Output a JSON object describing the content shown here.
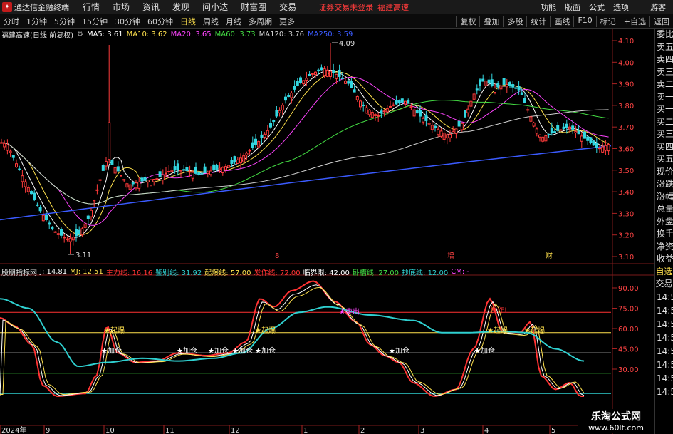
{
  "app": {
    "title": "通达信金融终端",
    "menus": [
      "行情",
      "市场",
      "资讯",
      "发现",
      "问小达",
      "财富圈",
      "交易"
    ],
    "notice_text": "证券交易未登录",
    "notice_stock": "福建高速",
    "right_menus": [
      "功能",
      "版面",
      "公式",
      "选项"
    ],
    "guest_label": "游客"
  },
  "toolbar": {
    "periods": [
      "分时",
      "1分钟",
      "5分钟",
      "15分钟",
      "30分钟",
      "60分钟",
      "日线",
      "周线",
      "月线",
      "多周期",
      "更多"
    ],
    "active_period": "日线",
    "tools": [
      "复权",
      "叠加",
      "多股",
      "统计",
      "画线",
      "F10",
      "标记",
      "+自选",
      "返回"
    ]
  },
  "price_chart": {
    "stock_title": "福建高速(日线 前复权)",
    "ma": [
      {
        "label": "MA5: 3.61",
        "color": "#ffffff"
      },
      {
        "label": "MA10: 3.62",
        "color": "#ffe14d"
      },
      {
        "label": "MA20: 3.65",
        "color": "#ff44ff"
      },
      {
        "label": "MA60: 3.73",
        "color": "#44dd44"
      },
      {
        "label": "MA120: 3.76",
        "color": "#d0d0d0"
      },
      {
        "label": "MA250: 3.59",
        "color": "#3b5bff"
      }
    ],
    "y_ticks": [
      "4.10",
      "4.00",
      "3.90",
      "3.80",
      "3.70",
      "3.60",
      "3.50",
      "3.40",
      "3.30",
      "3.20",
      "3.10"
    ],
    "high_label": "4.09",
    "low_label": "3.11",
    "event_markers": [
      {
        "text": "8",
        "color": "#ff4444"
      },
      {
        "text": "增",
        "color": "#ff4444"
      },
      {
        "text": "财",
        "color": "#ffe14d"
      }
    ]
  },
  "indicator": {
    "name": "股朋指标网",
    "values": [
      {
        "label": "J: 14.81",
        "color": "#ffffff"
      },
      {
        "label": "MJ: 12.51",
        "color": "#ffe14d"
      },
      {
        "label": "主力线: 16.16",
        "color": "#ff3333"
      },
      {
        "label": "鉴别线: 31.92",
        "color": "#2fd0d0"
      },
      {
        "label": "起爆线: 57.00",
        "color": "#ffe14d"
      },
      {
        "label": "发作线: 72.00",
        "color": "#ff3333"
      },
      {
        "label": "临界限: 42.00",
        "color": "#ffffff"
      },
      {
        "label": "卧槽线: 27.00",
        "color": "#44dd44"
      },
      {
        "label": "抄底线: 12.00",
        "color": "#2fd0d0"
      },
      {
        "label": "CM: -",
        "color": "#ff44ff"
      }
    ],
    "y_ticks": [
      "90.00",
      "75.00",
      "60.00",
      "45.00",
      "30.00"
    ],
    "signals": {
      "qibao": "★起爆",
      "jiacang": "★加仓",
      "faqi": "发作!",
      "maichu": "★卖出"
    }
  },
  "x_axis": {
    "labels": [
      "2024年",
      "9",
      "10",
      "11",
      "12",
      "1",
      "2",
      "3",
      "4",
      "5"
    ]
  },
  "right_panel": {
    "quote_items": [
      "委比",
      "卖五",
      "卖四",
      "卖三",
      "卖二",
      "卖一",
      "买一",
      "买二",
      "买三",
      "买四",
      "买五",
      "现价",
      "涨跌",
      "涨幅",
      "总量",
      "外盘",
      "换手",
      "净资",
      "收益"
    ],
    "tabs": [
      "自选",
      "交易"
    ],
    "time_items": [
      "14:56",
      "14:56",
      "14:56",
      "14:56",
      "14:56",
      "14:56",
      "14:56",
      "14:56"
    ]
  },
  "watermark": {
    "line1": "乐淘公式网",
    "line2": "www.60lt.com"
  }
}
